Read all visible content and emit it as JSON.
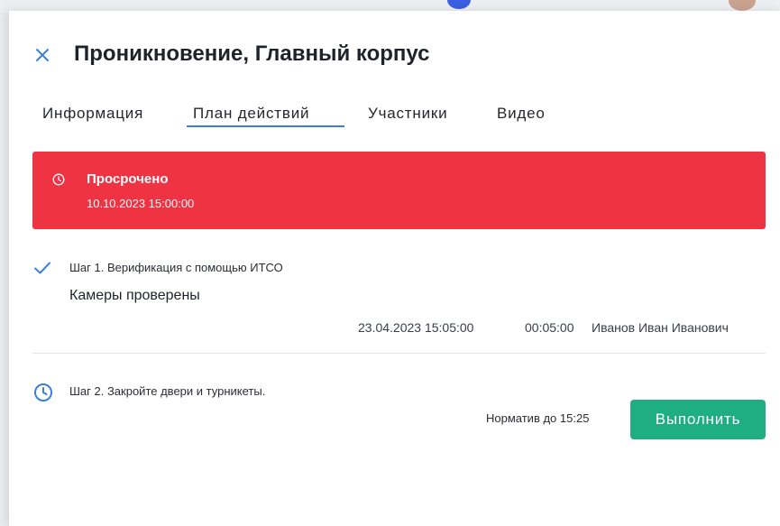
{
  "header": {
    "title": "Проникновение, Главный корпус"
  },
  "tabs": [
    {
      "label": "Информация",
      "active": false
    },
    {
      "label": "План действий",
      "active": true
    },
    {
      "label": "Участники",
      "active": false
    },
    {
      "label": "Видео",
      "active": false
    }
  ],
  "alert": {
    "title": "Просрочено",
    "datetime": "10.10.2023  15:00:00",
    "icon": "clock-icon",
    "color": "#ef3343"
  },
  "steps": [
    {
      "title": "Шаг 1. Верификация с помощью ИТСО",
      "status": "done",
      "icon": "check-icon",
      "result": "Камеры проверены",
      "date": "23.04.2023  15:05:00",
      "duration": "00:05:00",
      "author": "Иванов Иван Иванович"
    },
    {
      "title": "Шаг 2. Закройте двери и турникеты.",
      "status": "pending",
      "icon": "clock-icon",
      "deadline": "Норматив до 15:25",
      "action_label": "Выполнить",
      "action_color": "#1fad82"
    }
  ],
  "colors": {
    "accent": "#3d7fe0",
    "danger": "#ef3343",
    "success": "#1fad82"
  }
}
